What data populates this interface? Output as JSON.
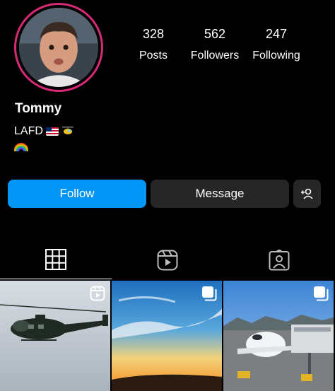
{
  "profile": {
    "name": "Tommy",
    "bio_line1": "LAFD",
    "bio_line1_emojis": [
      "us-flag-icon",
      "helicopter-icon"
    ],
    "bio_line2_emojis": [
      "rainbow-icon"
    ],
    "ring_color": "#d62976"
  },
  "stats": {
    "posts": {
      "value": "328",
      "label": "Posts"
    },
    "followers": {
      "value": "562",
      "label": "Followers"
    },
    "following": {
      "value": "247",
      "label": "Following"
    }
  },
  "actions": {
    "follow_label": "Follow",
    "message_label": "Message",
    "add_user_icon": "add-person-icon",
    "follow_color": "#0095f6",
    "secondary_color": "#262626"
  },
  "tabs": [
    {
      "name": "posts-grid",
      "icon": "grid-icon",
      "active": true
    },
    {
      "name": "reels",
      "icon": "reels-icon",
      "active": false
    },
    {
      "name": "tagged",
      "icon": "tagged-icon",
      "active": false
    }
  ],
  "posts": [
    {
      "subject": "helicopter",
      "badge": "reels-icon"
    },
    {
      "subject": "sunset-sky",
      "badge": "carousel-icon"
    },
    {
      "subject": "airport-plane",
      "badge": "carousel-icon"
    }
  ]
}
